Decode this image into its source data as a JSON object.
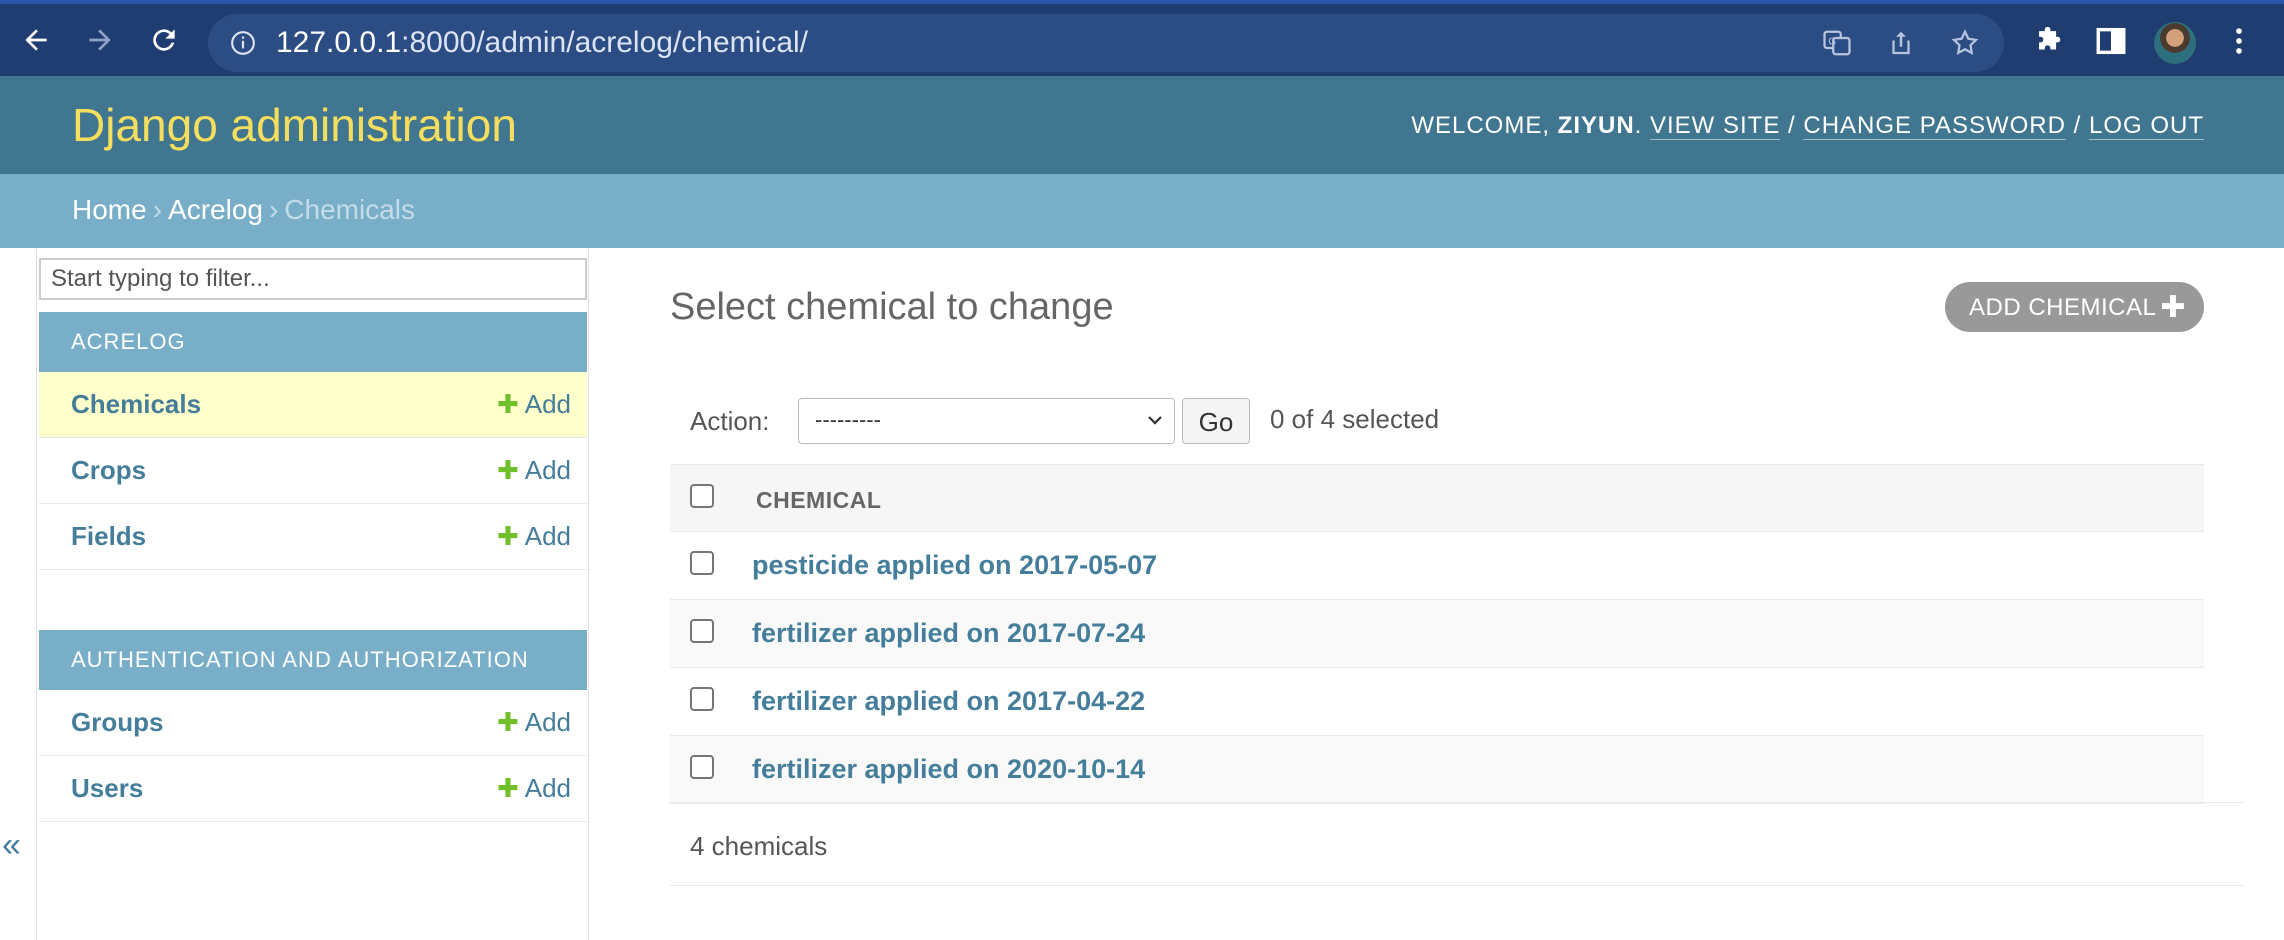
{
  "browser": {
    "url_host": "127.0.0.1",
    "url_rest": ":8000/admin/acrelog/chemical/"
  },
  "header": {
    "branding": "Django administration",
    "welcome": "WELCOME, ",
    "username": "ZIYUN",
    "view_site": "VIEW SITE",
    "change_password": "CHANGE PASSWORD",
    "log_out": "LOG OUT"
  },
  "breadcrumbs": {
    "home": "Home",
    "app": "Acrelog",
    "current": "Chemicals",
    "separator": "›"
  },
  "sidebar": {
    "filter_placeholder": "Start typing to filter...",
    "apps": [
      {
        "name": "ACRELOG",
        "models": [
          {
            "name": "Chemicals",
            "add": "Add"
          },
          {
            "name": "Crops",
            "add": "Add"
          },
          {
            "name": "Fields",
            "add": "Add"
          }
        ]
      },
      {
        "name": "AUTHENTICATION AND AUTHORIZATION",
        "models": [
          {
            "name": "Groups",
            "add": "Add"
          },
          {
            "name": "Users",
            "add": "Add"
          }
        ]
      }
    ],
    "toggle": "«"
  },
  "content": {
    "title": "Select chemical to change",
    "add_button": "ADD CHEMICAL",
    "action_label": "Action:",
    "action_value": "---------",
    "go": "Go",
    "selected": "0 of 4 selected",
    "column_header": "CHEMICAL",
    "rows": [
      "pesticide applied on 2017-05-07",
      "fertilizer applied on 2017-07-24",
      "fertilizer applied on 2017-04-22",
      "fertilizer applied on 2020-10-14"
    ],
    "count": "4 chemicals"
  },
  "colors": {
    "header": "#417690",
    "breadcrumbs": "#79aec8",
    "branding": "#f5dd5d",
    "link": "#447e9b",
    "add_plus": "#70bf2b",
    "current_row": "#ffffcc"
  }
}
